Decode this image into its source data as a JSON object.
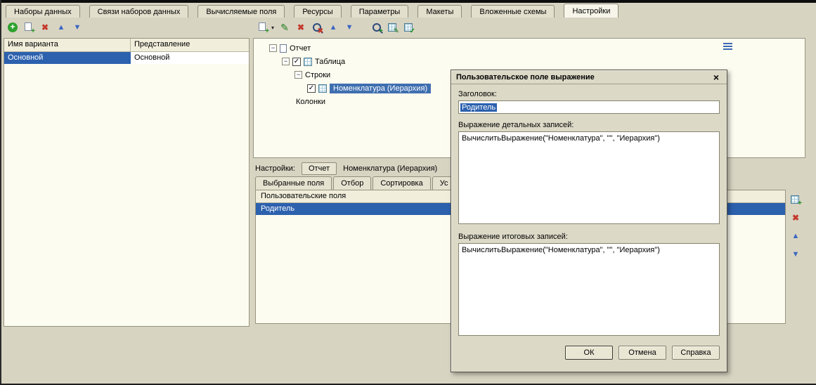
{
  "window": {
    "tabs": [
      {
        "label": "Наборы данных"
      },
      {
        "label": "Связи наборов данных"
      },
      {
        "label": "Вычисляемые поля"
      },
      {
        "label": "Ресурсы"
      },
      {
        "label": "Параметры"
      },
      {
        "label": "Макеты"
      },
      {
        "label": "Вложенные схемы"
      },
      {
        "label": "Настройки",
        "active": true
      }
    ]
  },
  "variants": {
    "columns": {
      "name": "Имя варианта",
      "presentation": "Представление"
    },
    "row": {
      "name": "Основной",
      "presentation": "Основной"
    }
  },
  "tree": {
    "items": [
      {
        "label": "Отчет"
      },
      {
        "label": "Таблица",
        "checked": true
      },
      {
        "label": "Строки"
      },
      {
        "label": "Номенклатура (Иерархия)",
        "checked": true,
        "selected": true
      },
      {
        "label": "Колонки"
      }
    ]
  },
  "settings": {
    "label": "Настройки:",
    "report_button": "Отчет",
    "path_label": "Номенклатура (Иерархия)",
    "tabs": [
      {
        "label": "Выбранные поля"
      },
      {
        "label": "Отбор"
      },
      {
        "label": "Сортировка"
      },
      {
        "label": "Ус"
      }
    ],
    "table_header": "Пользовательские поля",
    "selected_row": "Родитель"
  },
  "dialog": {
    "title": "Пользовательское поле выражение",
    "header_label": "Заголовок:",
    "header_value": "Родитель",
    "detail_label": "Выражение детальных записей:",
    "detail_value": "ВычислитьВыражение(\"Номенклатура\", \"\", \"Иерархия\")",
    "total_label": "Выражение итоговых записей:",
    "total_value": "ВычислитьВыражение(\"Номенклатура\", \"\", \"Иерархия\")",
    "ok": "ОК",
    "cancel": "Отмена",
    "help": "Справка"
  },
  "icons": {
    "plus": "+",
    "dropdown": "▾",
    "edit": "✎",
    "delete": "✖",
    "up": "▲",
    "down": "▼",
    "check": "✓",
    "collapse": "−",
    "close": "×"
  },
  "colors": {
    "selection_blue": "#2c61ae",
    "tree_selection_blue": "#3f6fb0",
    "background_beige": "#d8d4c2",
    "panel_cream": "#fdfcf0",
    "header_cream": "#f1eedb"
  }
}
